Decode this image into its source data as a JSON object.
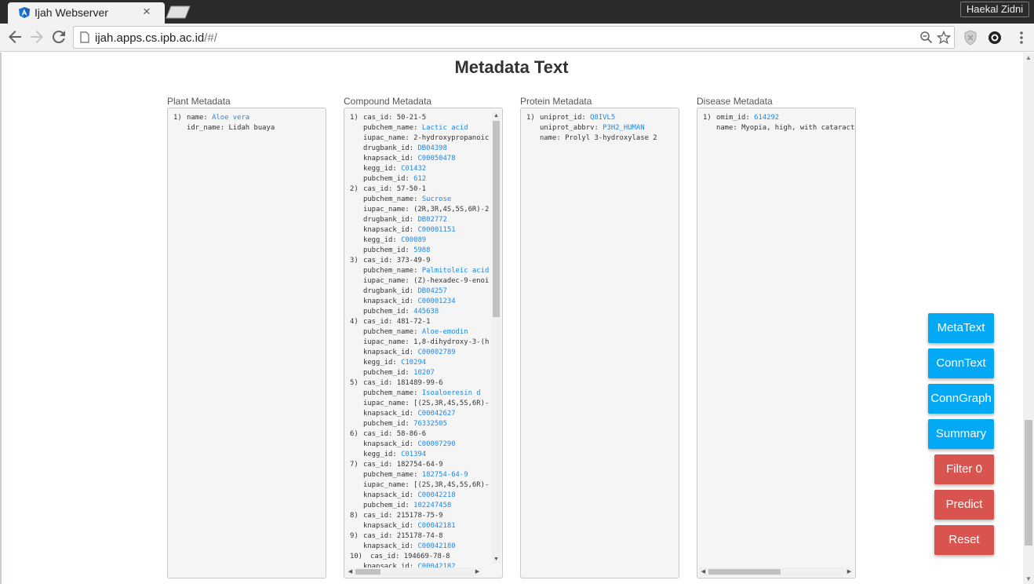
{
  "browser": {
    "tab_title": "Ijah Webserver",
    "tab_close": "×",
    "profile_name": "Haekal Zidni",
    "url_host": "ijah.apps.cs.ipb.ac.id",
    "url_path": "/#/"
  },
  "page": {
    "title": "Metadata Text"
  },
  "panels": {
    "plant": {
      "label": "Plant Metadata",
      "lines": [
        {
          "prefix": "1) ",
          "key": "name: ",
          "value": "Aloe vera",
          "link": true
        },
        {
          "prefix": "",
          "key": "idr_name: ",
          "value": "Lidah buaya",
          "link": false
        }
      ]
    },
    "compound": {
      "label": "Compound Metadata",
      "lines": [
        {
          "prefix": "1) ",
          "key": "cas_id: ",
          "value": "50-21-5",
          "link": false
        },
        {
          "prefix": "",
          "key": "pubchem_name: ",
          "value": "Lactic acid",
          "link": true
        },
        {
          "prefix": "",
          "key": "iupac_name: ",
          "value": "2-hydroxypropanoic",
          "link": false
        },
        {
          "prefix": "",
          "key": "drugbank_id: ",
          "value": "DB04398",
          "link": true
        },
        {
          "prefix": "",
          "key": "knapsack_id: ",
          "value": "C00050478",
          "link": true
        },
        {
          "prefix": "",
          "key": "kegg_id: ",
          "value": "C01432",
          "link": true
        },
        {
          "prefix": "",
          "key": "pubchem_id: ",
          "value": "612",
          "link": true
        },
        {
          "prefix": "2) ",
          "key": "cas_id: ",
          "value": "57-50-1",
          "link": false
        },
        {
          "prefix": "",
          "key": "pubchem_name: ",
          "value": "Sucrose",
          "link": true
        },
        {
          "prefix": "",
          "key": "iupac_name: ",
          "value": "(2R,3R,4S,5S,6R)-2",
          "link": false
        },
        {
          "prefix": "",
          "key": "drugbank_id: ",
          "value": "DB02772",
          "link": true
        },
        {
          "prefix": "",
          "key": "knapsack_id: ",
          "value": "C00001151",
          "link": true
        },
        {
          "prefix": "",
          "key": "kegg_id: ",
          "value": "C00089",
          "link": true
        },
        {
          "prefix": "",
          "key": "pubchem_id: ",
          "value": "5988",
          "link": true
        },
        {
          "prefix": "3) ",
          "key": "cas_id: ",
          "value": "373-49-9",
          "link": false
        },
        {
          "prefix": "",
          "key": "pubchem_name: ",
          "value": "Palmitoleic acid",
          "link": true
        },
        {
          "prefix": "",
          "key": "iupac_name: ",
          "value": "(Z)-hexadec-9-enoi",
          "link": false
        },
        {
          "prefix": "",
          "key": "drugbank_id: ",
          "value": "DB04257",
          "link": true
        },
        {
          "prefix": "",
          "key": "knapsack_id: ",
          "value": "C00001234",
          "link": true
        },
        {
          "prefix": "",
          "key": "pubchem_id: ",
          "value": "445638",
          "link": true
        },
        {
          "prefix": "4) ",
          "key": "cas_id: ",
          "value": "481-72-1",
          "link": false
        },
        {
          "prefix": "",
          "key": "pubchem_name: ",
          "value": "Aloe-emodin",
          "link": true
        },
        {
          "prefix": "",
          "key": "iupac_name: ",
          "value": "1,8-dihydroxy-3-(h",
          "link": false
        },
        {
          "prefix": "",
          "key": "knapsack_id: ",
          "value": "C00002789",
          "link": true
        },
        {
          "prefix": "",
          "key": "kegg_id: ",
          "value": "C10294",
          "link": true
        },
        {
          "prefix": "",
          "key": "pubchem_id: ",
          "value": "10207",
          "link": true
        },
        {
          "prefix": "5) ",
          "key": "cas_id: ",
          "value": "181489-99-6",
          "link": false
        },
        {
          "prefix": "",
          "key": "pubchem_name: ",
          "value": "Isoaloeresin d",
          "link": true
        },
        {
          "prefix": "",
          "key": "iupac_name: ",
          "value": "[(2S,3R,4S,5S,6R)-",
          "link": false
        },
        {
          "prefix": "",
          "key": "knapsack_id: ",
          "value": "C00042627",
          "link": true
        },
        {
          "prefix": "",
          "key": "pubchem_id: ",
          "value": "76332505",
          "link": true
        },
        {
          "prefix": "6) ",
          "key": "cas_id: ",
          "value": "58-86-6",
          "link": false
        },
        {
          "prefix": "",
          "key": "knapsack_id: ",
          "value": "C00007290",
          "link": true
        },
        {
          "prefix": "",
          "key": "kegg_id: ",
          "value": "C01394",
          "link": true
        },
        {
          "prefix": "7) ",
          "key": "cas_id: ",
          "value": "182754-64-9",
          "link": false
        },
        {
          "prefix": "",
          "key": "pubchem_name: ",
          "value": "182754-64-9",
          "link": true
        },
        {
          "prefix": "",
          "key": "iupac_name: ",
          "value": "[(2S,3R,4S,5S,6R)-",
          "link": false
        },
        {
          "prefix": "",
          "key": "knapsack_id: ",
          "value": "C00042218",
          "link": true
        },
        {
          "prefix": "",
          "key": "pubchem_id: ",
          "value": "102247458",
          "link": true
        },
        {
          "prefix": "8) ",
          "key": "cas_id: ",
          "value": "215178-75-9",
          "link": false
        },
        {
          "prefix": "",
          "key": "knapsack_id: ",
          "value": "C00042181",
          "link": true
        },
        {
          "prefix": "9) ",
          "key": "cas_id: ",
          "value": "215178-74-8",
          "link": false
        },
        {
          "prefix": "",
          "key": "knapsack_id: ",
          "value": "C00042180",
          "link": true
        },
        {
          "prefix": "10) ",
          "key": "cas_id: ",
          "value": "194669-78-8",
          "link": false
        },
        {
          "prefix": "",
          "key": "knapsack_id: ",
          "value": "C00042182",
          "link": true
        }
      ]
    },
    "protein": {
      "label": "Protein Metadata",
      "lines": [
        {
          "prefix": "1) ",
          "key": "uniprot_id: ",
          "value": "Q8IVL5",
          "link": true
        },
        {
          "prefix": "",
          "key": "uniprot_abbrv: ",
          "value": "P3H2_HUMAN",
          "link": true
        },
        {
          "prefix": "",
          "key": "name: ",
          "value": "Prolyl 3-hydroxylase 2",
          "link": false
        }
      ]
    },
    "disease": {
      "label": "Disease Metadata",
      "lines": [
        {
          "prefix": "1) ",
          "key": "omim_id: ",
          "value": "614292",
          "link": true
        },
        {
          "prefix": "",
          "key": "name: ",
          "value": "Myopia, high, with cataract",
          "link": false
        }
      ]
    }
  },
  "actions": {
    "metatext": "MetaText",
    "conntext": "ConnText",
    "conngraph": "ConnGraph",
    "summary": "Summary",
    "filter": "Filter 0",
    "predict": "Predict",
    "reset": "Reset"
  },
  "colors": {
    "primary_blue": "#03a9f4",
    "danger_red": "#d9534f",
    "link_blue": "#1e88e5"
  },
  "icons": [
    "back-arrow-icon",
    "forward-arrow-icon",
    "reload-icon",
    "page-icon",
    "zoom-icon",
    "star-icon",
    "shield-extension-icon",
    "camera-extension-icon",
    "menu-dots-icon"
  ]
}
